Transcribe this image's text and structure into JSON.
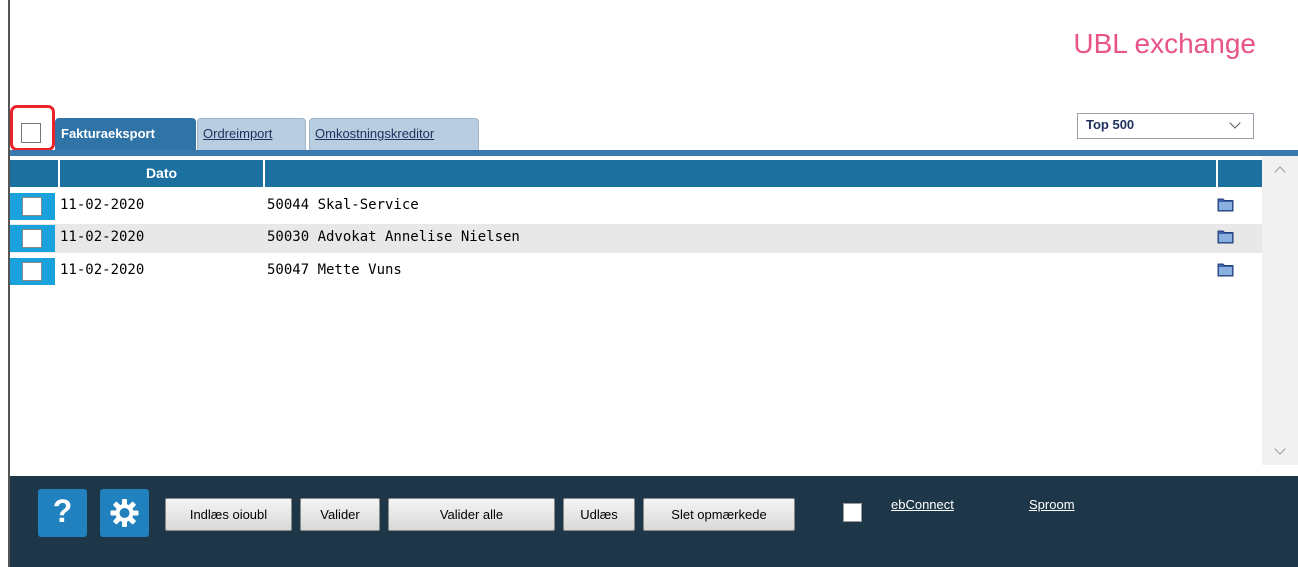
{
  "app": {
    "title": "UBL exchange"
  },
  "tabs": [
    {
      "label": "Fakturaeksport",
      "active": true
    },
    {
      "label": "Ordreimport",
      "active": false
    },
    {
      "label": "Omkostningskreditor",
      "active": false
    }
  ],
  "filter": {
    "selected": "Top 500"
  },
  "table": {
    "columns": [
      "",
      "Dato",
      "",
      ""
    ],
    "rows": [
      {
        "date": "11-02-2020",
        "name": "50044 Skal-Service"
      },
      {
        "date": "11-02-2020",
        "name": "50030 Advokat Annelise Nielsen"
      },
      {
        "date": "11-02-2020",
        "name": "50047 Mette Vuns"
      }
    ]
  },
  "footer": {
    "help_icon": "?",
    "buttons": {
      "indlaes": "Indlæs oioubl",
      "valider": "Valider",
      "valider_alle": "Valider alle",
      "udlaes": "Udlæs",
      "slet": "Slet opmærkede"
    },
    "links": {
      "ebconnect": "ebConnect",
      "sproom": "Sproom"
    }
  },
  "colors": {
    "title": "#e8538a",
    "tab_active": "#2f73a7",
    "header": "#1b70a0",
    "checkbox_cell": "#1aa2dc",
    "footer_bg": "#1e3748",
    "icon_button": "#2181be",
    "highlight": "#e8232a"
  }
}
